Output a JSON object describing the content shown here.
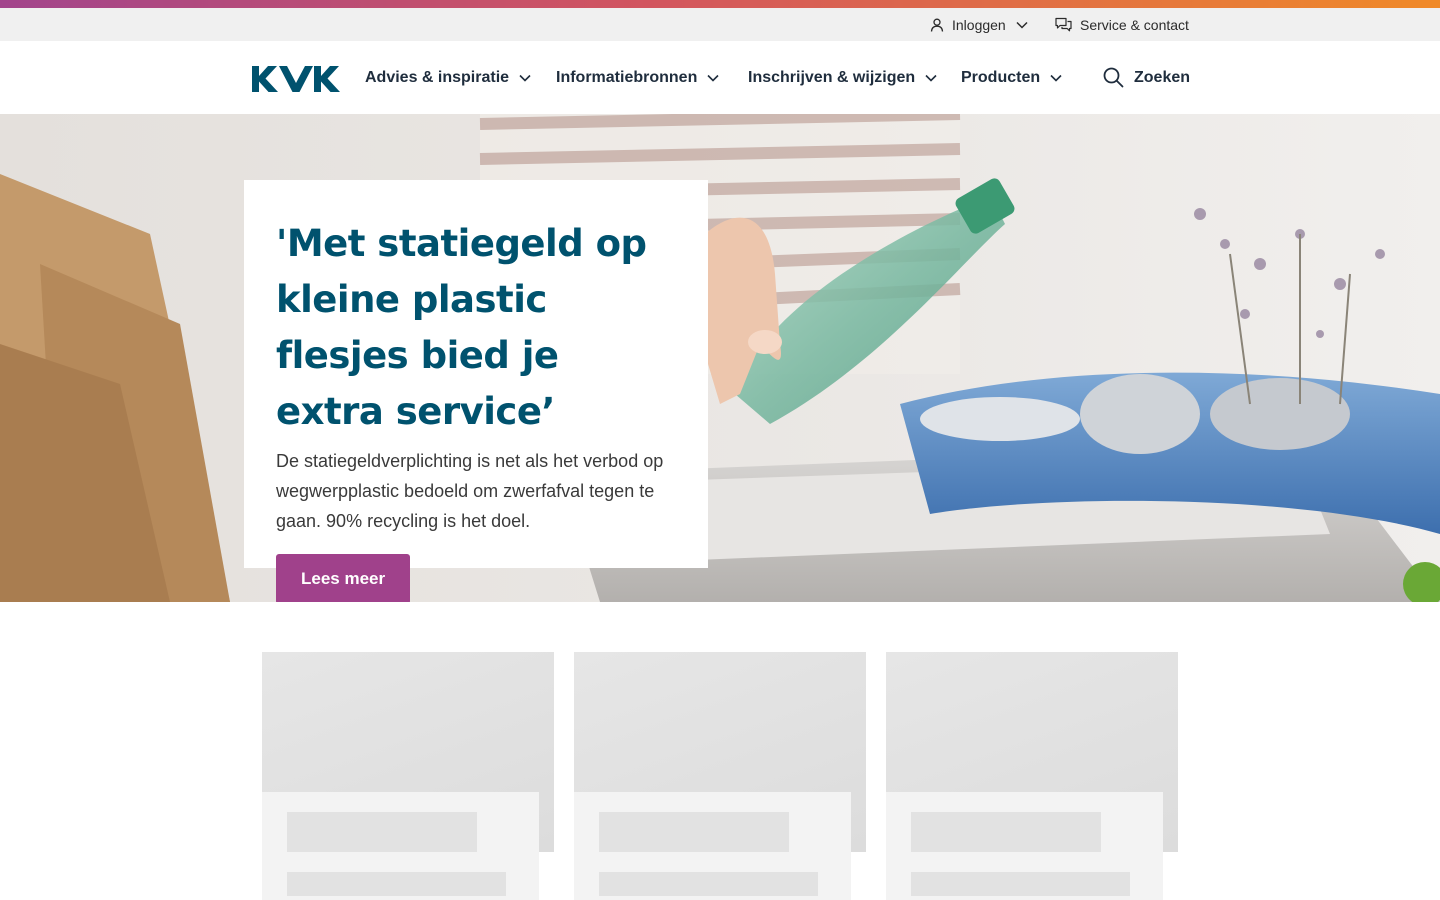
{
  "colors": {
    "brand_blue": "#00526e",
    "accent_purple": "#a0418b",
    "stripe_start": "#a2448c",
    "stripe_end": "#f08a28",
    "utility_bg": "#f0f0f0"
  },
  "utility": {
    "login_label": "Inloggen",
    "login_icon": "user-icon",
    "service_label": "Service & contact",
    "service_icon": "chat-bubbles-icon"
  },
  "nav": {
    "logo_text": "KVK",
    "items": [
      {
        "label": "Advies & inspiratie",
        "icon": "chevron-down-icon"
      },
      {
        "label": "Informatiebronnen",
        "icon": "chevron-down-icon"
      },
      {
        "label": "Inschrijven & wijzigen",
        "icon": "chevron-down-icon"
      },
      {
        "label": "Producten",
        "icon": "chevron-down-icon"
      }
    ],
    "search_label": "Zoeken",
    "search_icon": "search-icon"
  },
  "hero": {
    "title": "'Met statiegeld op kleine plastic flesjes bied je extra service’",
    "text": "De statiegeldverplichting is net als het verbod op wegwerpplastic bedoeld om zwerfafval tegen te gaan. 90% recycling is het doel.",
    "button_label": "Lees meer"
  }
}
